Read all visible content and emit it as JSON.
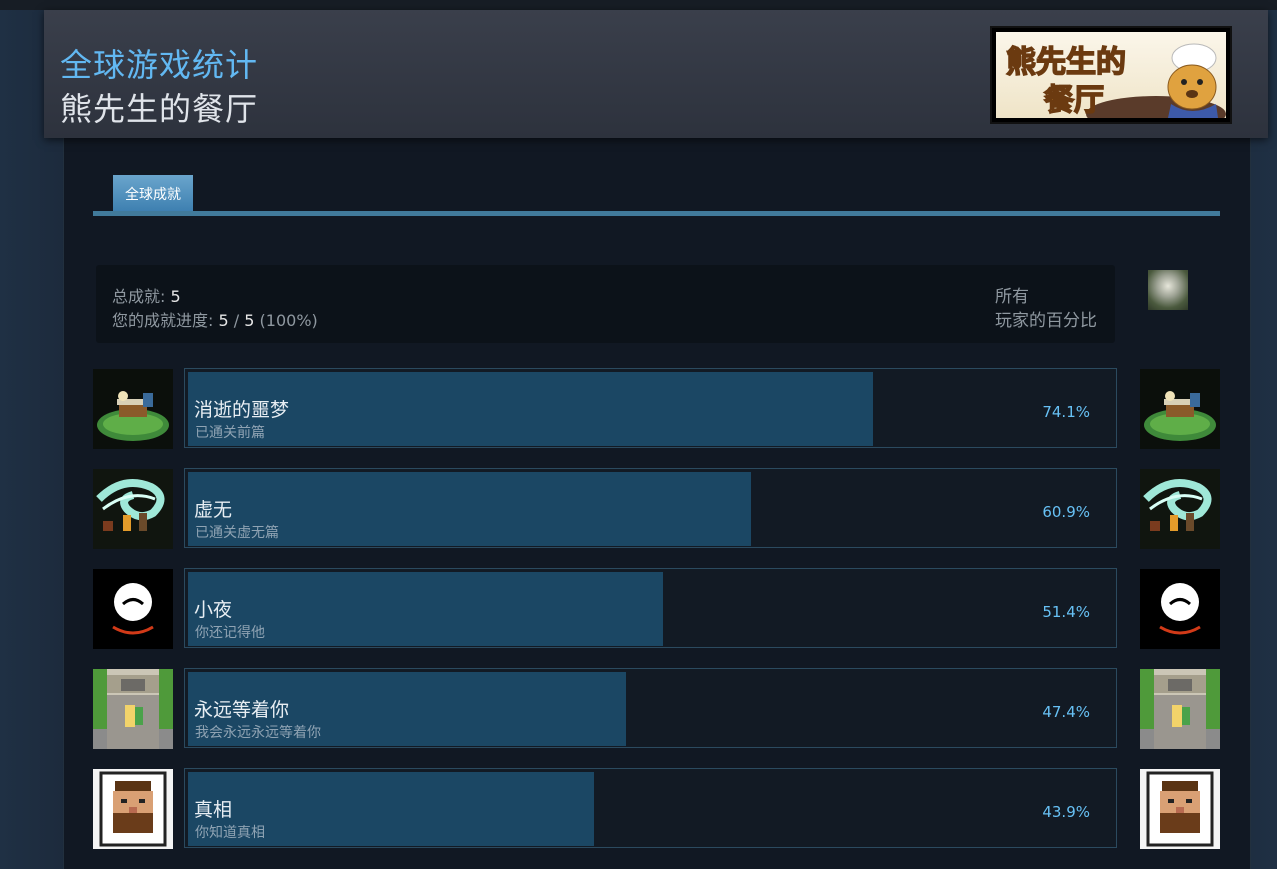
{
  "header": {
    "title": "全球游戏统计",
    "game_name": "熊先生的餐厅",
    "logo_text_line1": "熊先生的",
    "logo_text_line2": "餐厅"
  },
  "tabs": [
    {
      "label": "全球成就",
      "active": true
    }
  ],
  "summary": {
    "total_label": "总成就:",
    "total_value": "5",
    "progress_label": "您的成就进度:",
    "progress_current": "5",
    "progress_sep": "/",
    "progress_total": "5",
    "progress_percent": "(100%)",
    "right_line1": "所有",
    "right_line2": "玩家的百分比"
  },
  "achievements": [
    {
      "name": "消逝的噩梦",
      "description": "已通关前篇",
      "percent_label": "74.1%",
      "percent": 74.1,
      "icon": "garden-table-icon"
    },
    {
      "name": "虚无",
      "description": "已通关虚无篇",
      "percent_label": "60.9%",
      "percent": 60.9,
      "icon": "wind-spirit-icon"
    },
    {
      "name": "小夜",
      "description": "你还记得他",
      "percent_label": "51.4%",
      "percent": 51.4,
      "icon": "sad-face-icon"
    },
    {
      "name": "永远等着你",
      "description": "我会永远永远等着你",
      "percent_label": "47.4%",
      "percent": 47.4,
      "icon": "waiting-girl-icon"
    },
    {
      "name": "真相",
      "description": "你知道真相",
      "percent_label": "43.9%",
      "percent": 43.9,
      "icon": "bearded-man-portrait-icon"
    }
  ],
  "colors": {
    "accent": "#67c1f5",
    "title_blue": "#62b8f2",
    "bar_fill": "#1b4764",
    "tab_line": "#417a9b"
  }
}
